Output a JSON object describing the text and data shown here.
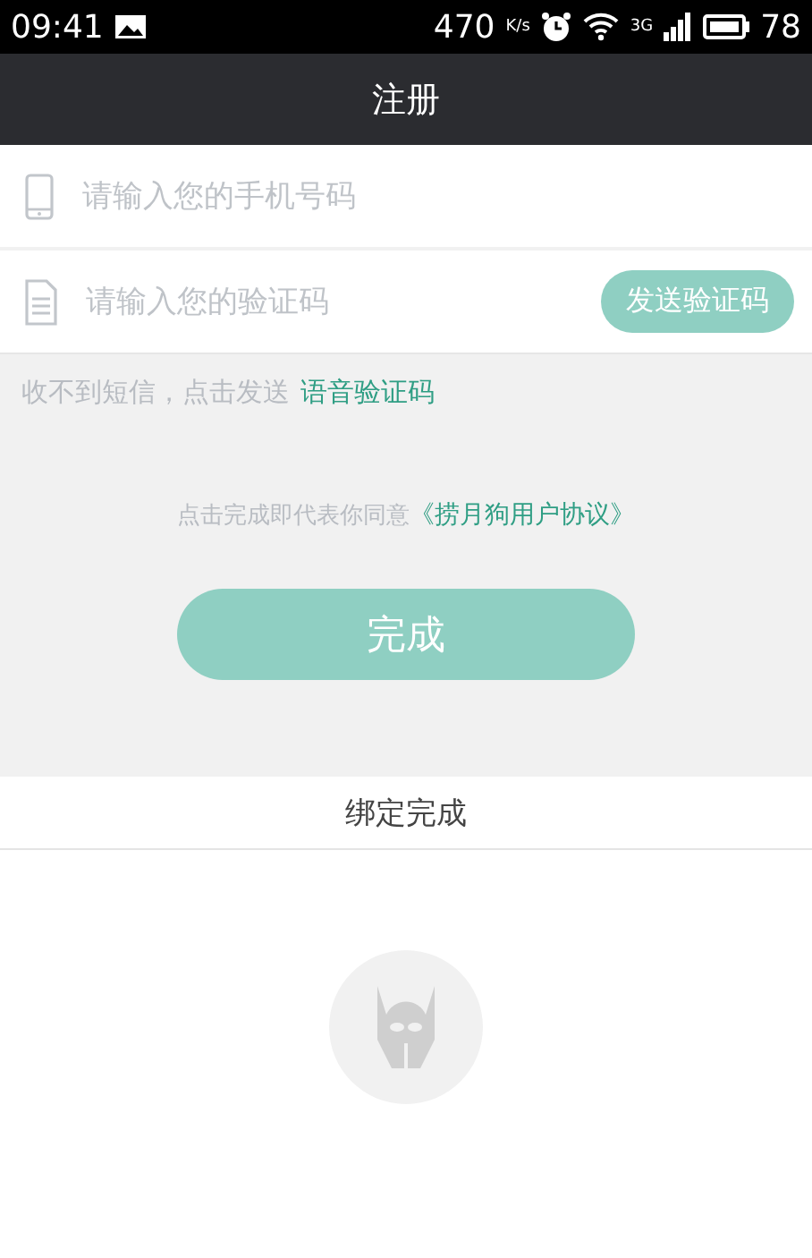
{
  "status_bar": {
    "time": "09:41",
    "speed": "470",
    "speed_unit": "K/s",
    "network": "3G",
    "battery": "78"
  },
  "title": "注册",
  "fields": [
    {
      "kind": "phone",
      "placeholder": "请输入您的手机号码"
    },
    {
      "kind": "code",
      "placeholder": "请输入您的验证码",
      "button": "发送验证码"
    }
  ],
  "voice_hint": {
    "text": "收不到短信，点击发送",
    "link": "语音验证码"
  },
  "agreement": {
    "text": "点击完成即代表你同意",
    "link": "《捞月狗用户协议》"
  },
  "submit": "完成",
  "bind_label": "绑定完成"
}
